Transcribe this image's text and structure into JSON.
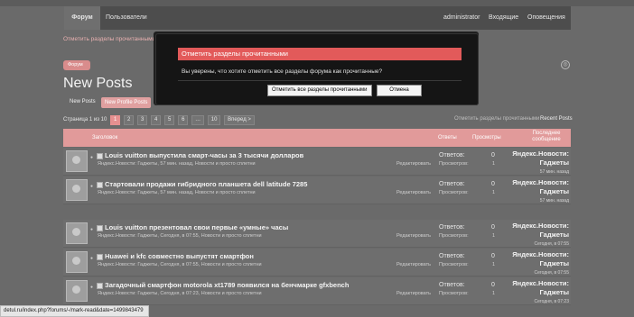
{
  "nav": {
    "forum": "Форум",
    "users": "Пользователи",
    "admin": "administrator",
    "login": "Входящие",
    "alerts": "Оповещения"
  },
  "sublink": "Отметить разделы прочитанными",
  "path_tag": "Форум",
  "page_title": "New Posts",
  "tabs": {
    "new_posts": "New Posts",
    "new_profile_posts": "New Profile Posts"
  },
  "pagenav": {
    "label": "Страница 1 из 10",
    "pages": [
      "1",
      "2",
      "3",
      "4",
      "5",
      "6"
    ],
    "ellipsis": "…",
    "next": "10",
    "goto": "Вперед >"
  },
  "links": {
    "mark_read": "Отметить разделы прочитанными",
    "recent": "Recent Posts"
  },
  "table": {
    "col_title": "Заголовок",
    "col_replies": "Ответы",
    "col_views": "Просмотры",
    "col_last": "Последнее сообщение"
  },
  "threads": [
    {
      "title": "Louis vuitton выпустила смарт-часы за 3 тысячи долларов",
      "meta": "Яндекс.Новости: Гаджеты, 57 мин. назад, Новости и просто сплетни",
      "edit": "Редактировать",
      "replies_label": "Ответов:",
      "replies": "0",
      "views_label": "Просмотров:",
      "views": "1",
      "last_user": "Яндекс.Новости: Гаджеты",
      "last_time": "57 мин. назад"
    },
    {
      "title": "Стартовали продажи гибридного планшета dell latitude 7285",
      "meta": "Яндекс.Новости: Гаджеты, 57 мин. назад, Новости и просто сплетни",
      "edit": "Редактировать",
      "replies_label": "Ответов:",
      "replies": "0",
      "views_label": "Просмотров:",
      "views": "1",
      "last_user": "Яндекс.Новости: Гаджеты",
      "last_time": "57 мин. назад"
    },
    {
      "title": "Louis vuitton презентовал свои первые «умные» часы",
      "meta": "Яндекс.Новости: Гаджеты, Сегодня, в 07:55, Новости и просто сплетни",
      "edit": "Редактировать",
      "replies_label": "Ответов:",
      "replies": "0",
      "views_label": "Просмотров:",
      "views": "1",
      "last_user": "Яндекс.Новости: Гаджеты",
      "last_time": "Сегодня, в 07:55"
    },
    {
      "title": "Huawei и kfc совместно выпустят смартфон",
      "meta": "Яндекс.Новости: Гаджеты, Сегодня, в 07:55, Новости и просто сплетни",
      "edit": "Редактировать",
      "replies_label": "Ответов:",
      "replies": "0",
      "views_label": "Просмотров:",
      "views": "1",
      "last_user": "Яндекс.Новости: Гаджеты",
      "last_time": "Сегодня, в 07:55"
    },
    {
      "title": "Загадочный смартфон motorola xt1789 появился на бенчмарке gfxbench",
      "meta": "Яндекс.Новости: Гаджеты, Сегодня, в 07:23, Новости и просто сплетни",
      "edit": "Редактировать",
      "replies_label": "Ответов:",
      "replies": "0",
      "views_label": "Просмотров:",
      "views": "1",
      "last_user": "Яндекс.Новости: Гаджеты",
      "last_time": "Сегодня, в 07:23"
    }
  ],
  "dialog": {
    "title": "Отметить разделы прочитанными",
    "text": "Вы уверены, что хотите отметить все разделы форума как прочитанные?",
    "confirm": "Отметить все разделы прочитанными",
    "cancel": "Отмена"
  },
  "status_url": "detul.ru/index.php?forums/-/mark-read&date=1499843479",
  "colors": {
    "accent": "#e19a9a",
    "dialog_header": "#e25a5a"
  }
}
